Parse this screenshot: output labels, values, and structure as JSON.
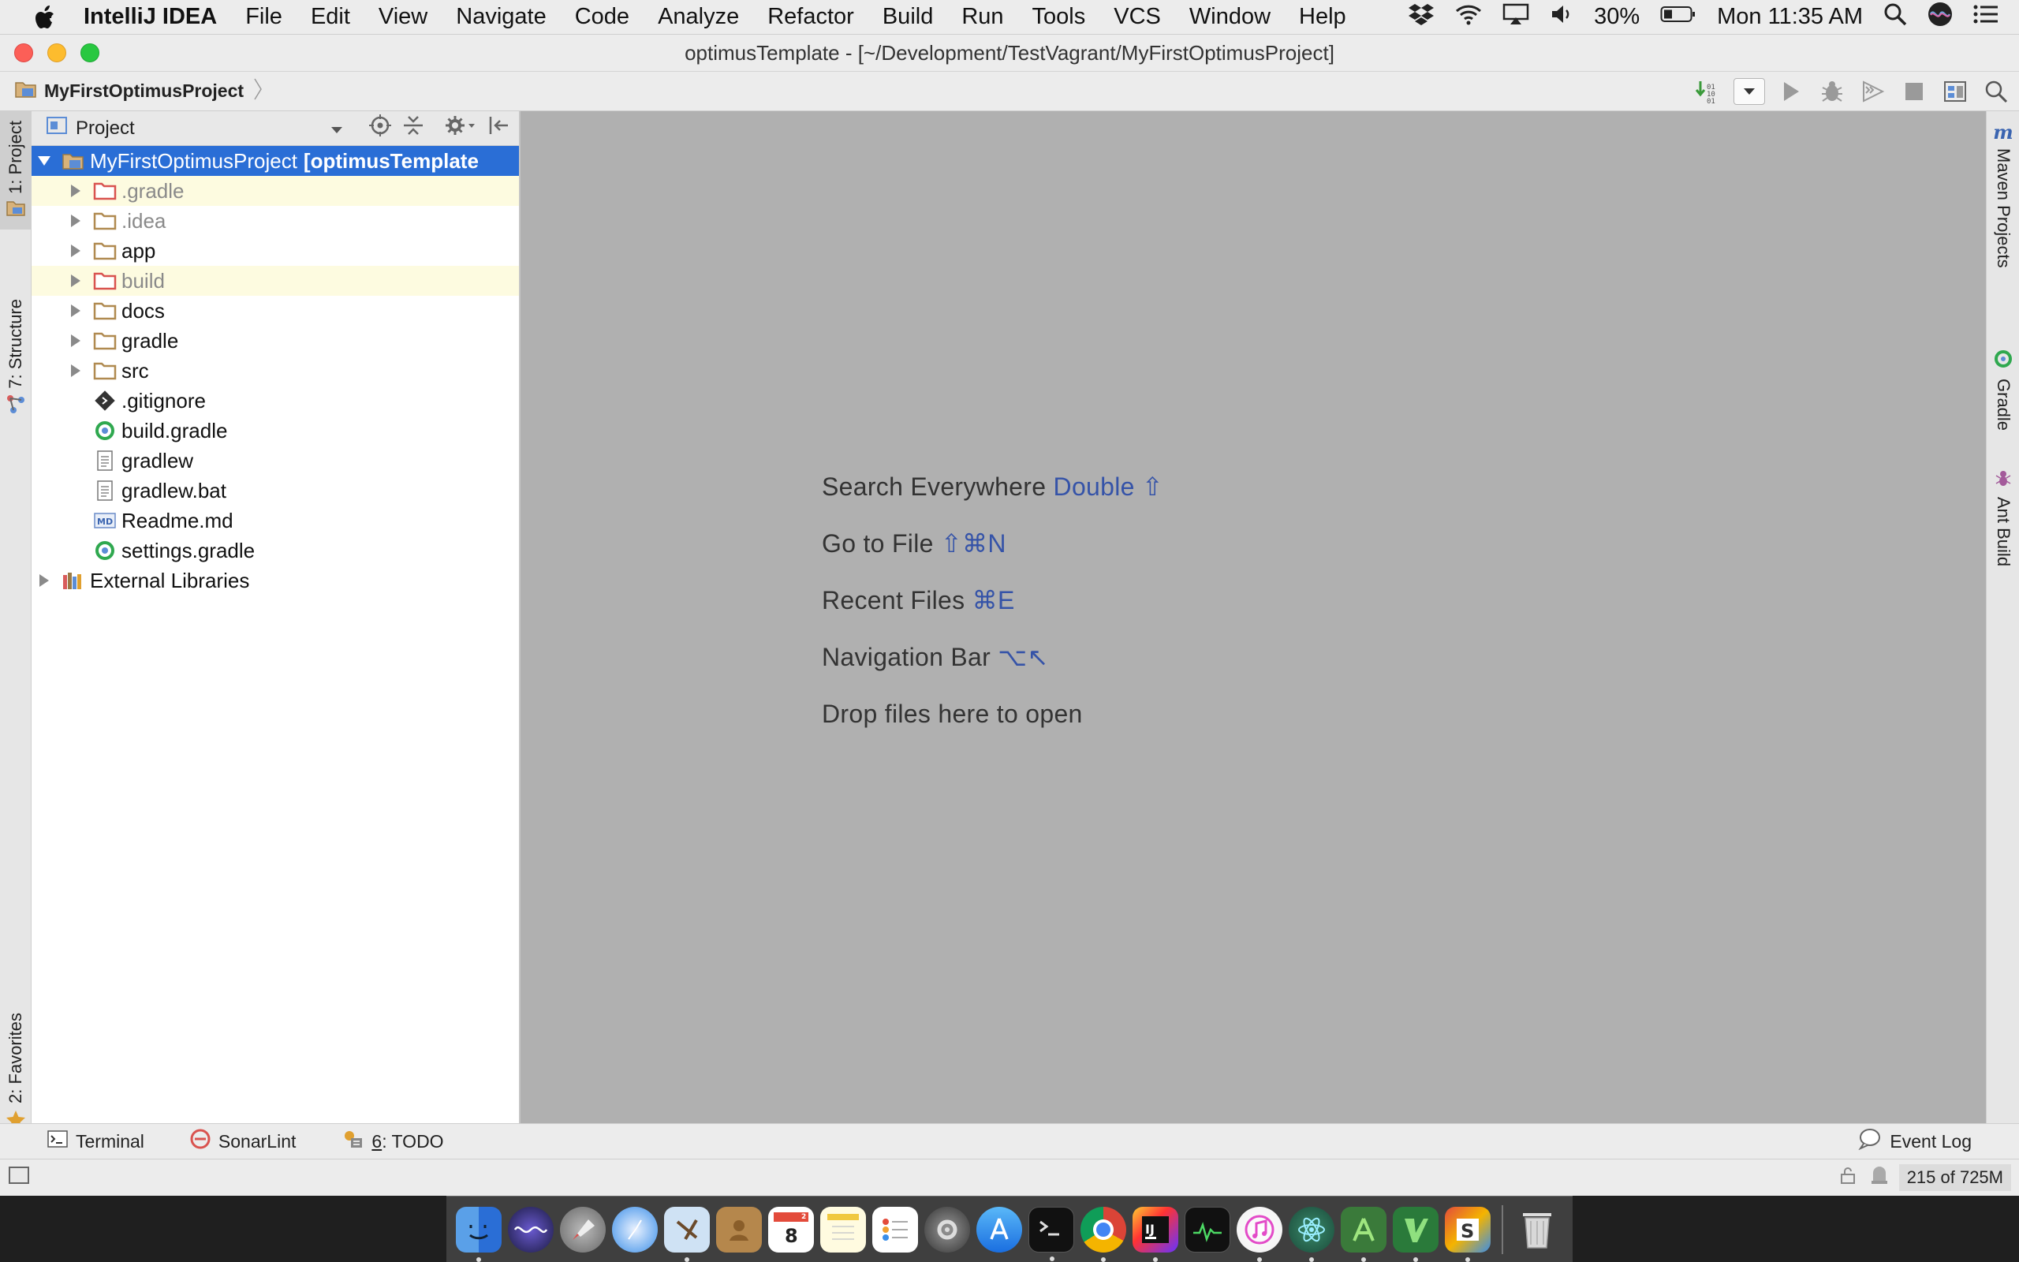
{
  "menubar": {
    "app_name": "IntelliJ IDEA",
    "items": [
      "File",
      "Edit",
      "View",
      "Navigate",
      "Code",
      "Analyze",
      "Refactor",
      "Build",
      "Run",
      "Tools",
      "VCS",
      "Window",
      "Help"
    ],
    "battery": "30%",
    "clock": "Mon 11:35 AM"
  },
  "window": {
    "title": "optimusTemplate - [~/Development/TestVagrant/MyFirstOptimusProject]"
  },
  "navbar": {
    "breadcrumb": "MyFirstOptimusProject"
  },
  "left_strip": {
    "project_tab": "1: Project",
    "structure_tab": "7: Structure",
    "favorites_tab": "2: Favorites"
  },
  "right_strip": {
    "maven_tab": "Maven Projects",
    "gradle_tab": "Gradle",
    "ant_tab": "Ant Build"
  },
  "project_panel": {
    "header": "Project",
    "root_name": "MyFirstOptimusProject",
    "root_module": "[optimusTemplate",
    "items": [
      {
        "label": ".gradle",
        "kind": "folder-excluded"
      },
      {
        "label": ".idea",
        "kind": "folder"
      },
      {
        "label": "app",
        "kind": "folder"
      },
      {
        "label": "build",
        "kind": "folder-excluded"
      },
      {
        "label": "docs",
        "kind": "folder"
      },
      {
        "label": "gradle",
        "kind": "folder"
      },
      {
        "label": "src",
        "kind": "folder"
      },
      {
        "label": ".gitignore",
        "kind": "git-file"
      },
      {
        "label": "build.gradle",
        "kind": "gradle-file"
      },
      {
        "label": "gradlew",
        "kind": "text-file"
      },
      {
        "label": "gradlew.bat",
        "kind": "text-file"
      },
      {
        "label": "Readme.md",
        "kind": "md-file"
      },
      {
        "label": "settings.gradle",
        "kind": "gradle-file"
      }
    ],
    "external_libraries": "External Libraries"
  },
  "editor": {
    "hints": [
      {
        "text": "Search Everywhere ",
        "key": "Double ⇧"
      },
      {
        "text": "Go to File ",
        "key": "⇧⌘N"
      },
      {
        "text": "Recent Files ",
        "key": "⌘E"
      },
      {
        "text": "Navigation Bar ",
        "key": "⌥↖"
      },
      {
        "text": "Drop files here to open",
        "key": ""
      }
    ]
  },
  "bottom_tools": {
    "terminal": "Terminal",
    "sonarlint": "SonarLint",
    "todo_num": "6",
    "todo": ": TODO",
    "event_log": "Event Log"
  },
  "statusbar": {
    "memory": "215 of 725M"
  },
  "colors": {
    "selection": "#2a6ed6",
    "excluded_folder": "#d9534f",
    "shortcut_key": "#3553a8",
    "editor_bg": "#b0b0b0"
  }
}
